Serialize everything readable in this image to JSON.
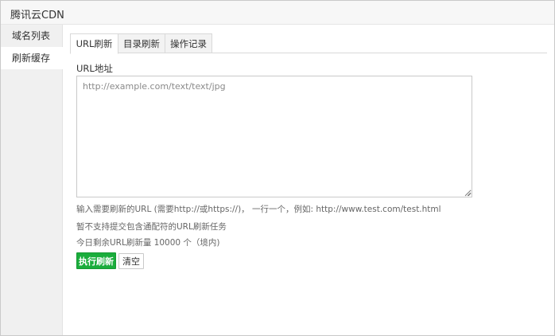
{
  "window": {
    "title": "腾讯云CDN"
  },
  "sidebar": {
    "items": [
      {
        "label": "域名列表",
        "active": false
      },
      {
        "label": "刷新缓存",
        "active": true
      }
    ]
  },
  "tabs": [
    {
      "label": "URL刷新",
      "active": true
    },
    {
      "label": "目录刷新",
      "active": false
    },
    {
      "label": "操作记录",
      "active": false
    }
  ],
  "form": {
    "url_label": "URL地址",
    "url_placeholder": "http://example.com/text/text/jpg",
    "url_value": "",
    "hint_format": "输入需要刷新的URL (需要http://或https://)， 一行一个，例如: http://www.test.com/test.html",
    "hint_wildcard": "暂不支持提交包含通配符的URL刷新任务",
    "hint_quota": "今日剩余URL刷新量 10000 个（境内)",
    "submit_label": "执行刷新",
    "clear_label": "清空"
  },
  "colors": {
    "primary": "#1aad3c",
    "sidebar_bg": "#f0f0f0",
    "title_bg": "#f7f7f7"
  }
}
